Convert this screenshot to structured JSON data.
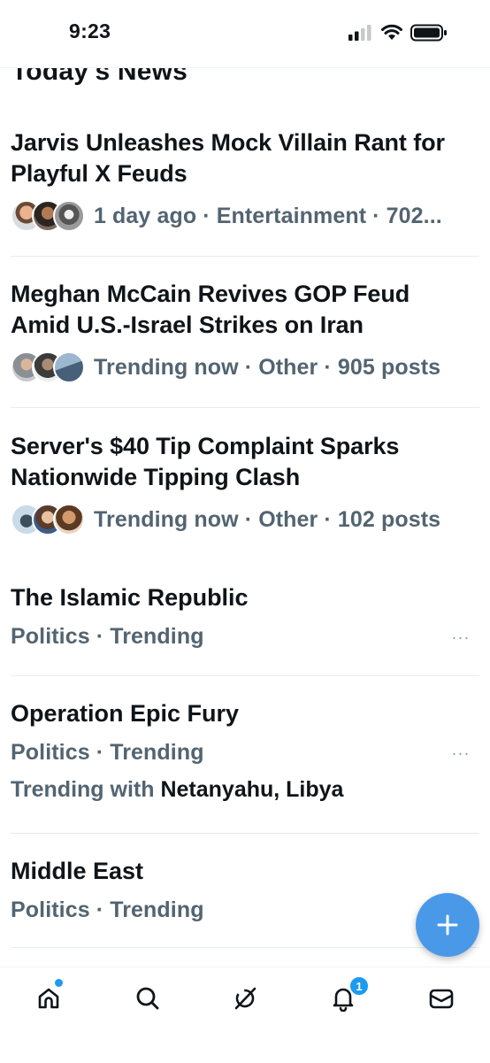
{
  "status_bar": {
    "time": "9:23"
  },
  "section": {
    "heading": "Today's News"
  },
  "stories": [
    {
      "title_line1": "Jarvis Unleashes Mock Villain Rant for",
      "title_line2": "Playful X Feuds",
      "meta": "1 day ago · Entertainment · 702..."
    },
    {
      "title_line1": "Meghan McCain Revives GOP Feud",
      "title_line2": "Amid U.S.-Israel Strikes on Iran",
      "meta": "Trending now · Other · 905 posts"
    },
    {
      "title_line1": "Server's $40 Tip Complaint Sparks",
      "title_line2": "Nationwide Tipping Clash",
      "meta": "Trending now · Other · 102 posts"
    }
  ],
  "trends": [
    {
      "title": "The Islamic Republic",
      "meta": "Politics · Trending"
    },
    {
      "title": "Operation Epic Fury",
      "meta": "Politics · Trending",
      "with_label": "Trending with",
      "with_names": "Netanyahu, Libya"
    },
    {
      "title": "Middle East",
      "meta": "Politics · Trending"
    }
  ],
  "more_glyph": "···",
  "fab": {
    "icon": "plus-icon"
  },
  "nav": {
    "items": [
      "home-icon",
      "search-icon",
      "grok-icon",
      "notifications-icon",
      "messages-icon"
    ],
    "notification_count": "1"
  },
  "colors": {
    "accent": "#1d9bf0",
    "fab": "#4a99e9",
    "secondary_text": "#536471",
    "primary_text": "#0f1419"
  }
}
